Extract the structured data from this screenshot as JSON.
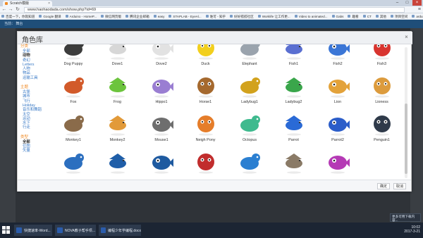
{
  "browser": {
    "tab_title": "Scratch模版",
    "url": "www.haohaodada.com/show.php?id=69",
    "bookmarks": [
      "百度一下，你就知道",
      "Google 翻译",
      "Arduino - HomeP...",
      "微信网页版",
      "腾讯企业邮箱",
      "easy",
      "STAPLAB - EyeAl...",
      "谁可 - 知乎",
      "好好搭搭社区",
      "Worklife 让工作更...",
      "Video to animated...",
      "Gabs",
      "趣看",
      "CT",
      "其他",
      "项目空间",
      "arduino",
      "BBC",
      "免费"
    ]
  },
  "page": {
    "top_text": "当前：  舞台"
  },
  "modal": {
    "title": "角色库",
    "close": "×",
    "ok_label": "确定",
    "cancel_label": "取消"
  },
  "sidebar": {
    "groups": [
      {
        "title": "分类",
        "items": [
          {
            "label": "全部",
            "active": false
          },
          {
            "label": "动物",
            "active": true
          },
          {
            "label": "奇幻",
            "active": false
          },
          {
            "label": "Letters",
            "active": false
          },
          {
            "label": "人物",
            "active": false
          },
          {
            "label": "物品",
            "active": false
          },
          {
            "label": "运输工具",
            "active": false
          }
        ]
      },
      {
        "title": "主题",
        "items": [
          {
            "label": "古堡",
            "active": false
          },
          {
            "label": "城市",
            "active": false
          },
          {
            "label": "飞行",
            "active": false
          },
          {
            "label": "Holiday",
            "active": false
          },
          {
            "label": "音乐和舞蹈",
            "active": false
          },
          {
            "label": "太空",
            "active": false
          },
          {
            "label": "运动",
            "active": false
          },
          {
            "label": "水下",
            "active": false
          },
          {
            "label": "行走",
            "active": false
          }
        ]
      },
      {
        "title": "类型",
        "items": [
          {
            "label": "全部",
            "active": true
          },
          {
            "label": "位图",
            "active": false
          },
          {
            "label": "矢量",
            "active": false
          }
        ]
      }
    ]
  },
  "sprites": [
    {
      "label": "Dog Puppy",
      "color": "#3c3c3c"
    },
    {
      "label": "Dove1",
      "color": "#d7d7d7"
    },
    {
      "label": "Dove2",
      "color": "#e2e2e2"
    },
    {
      "label": "Duck",
      "color": "#f2cf1d"
    },
    {
      "label": "Elephant",
      "color": "#9aa3ad"
    },
    {
      "label": "Fish1",
      "color": "#5a6fd1"
    },
    {
      "label": "Fish2",
      "color": "#3b76d6"
    },
    {
      "label": "Fish3",
      "color": "#d8342f"
    },
    {
      "label": "Fox",
      "color": "#d25a2a"
    },
    {
      "label": "Frog",
      "color": "#6cc43d"
    },
    {
      "label": "Hippo1",
      "color": "#9a7ed2"
    },
    {
      "label": "Horse1",
      "color": "#a5692e"
    },
    {
      "label": "Ladybug1",
      "color": "#d2a21d"
    },
    {
      "label": "Ladybug2",
      "color": "#3aa64b"
    },
    {
      "label": "Lion",
      "color": "#e3a23a"
    },
    {
      "label": "Lioness",
      "color": "#dc9b3d"
    },
    {
      "label": "Monkey1",
      "color": "#8a6b4a"
    },
    {
      "label": "Monkey2",
      "color": "#e29a39"
    },
    {
      "label": "Mouse1",
      "color": "#6e6e6e"
    },
    {
      "label": "Neigh Pony",
      "color": "#e57d2a"
    },
    {
      "label": "Octopus",
      "color": "#3fba8e"
    },
    {
      "label": "Parrot",
      "color": "#2a6ad6"
    },
    {
      "label": "Parrot2",
      "color": "#2b5dc9"
    },
    {
      "label": "Penguin1",
      "color": "#2f3a4a"
    },
    {
      "label": "",
      "color": "#2c6fbf"
    },
    {
      "label": "",
      "color": "#1f5ea8"
    },
    {
      "label": "",
      "color": "#1e5aa0"
    },
    {
      "label": "",
      "color": "#c12d2d"
    },
    {
      "label": "",
      "color": "#2b7fd1"
    },
    {
      "label": "",
      "color": "#8a7a66"
    },
    {
      "label": "",
      "color": "#b53ab5"
    }
  ],
  "taskbar": {
    "tasks": [
      {
        "label": "快捷速率-Word...",
        "color": "#2b5cab",
        "active": false
      },
      {
        "label": "NOVA教子帮手项...",
        "color": "#2b5cab",
        "active": false
      },
      {
        "label": "编程少年学编程.docx",
        "color": "#2b5cab",
        "active": false
      }
    ],
    "time": "10:02",
    "date": "2017-3-21"
  },
  "notice": {
    "text": "更多可用下载内容..."
  }
}
